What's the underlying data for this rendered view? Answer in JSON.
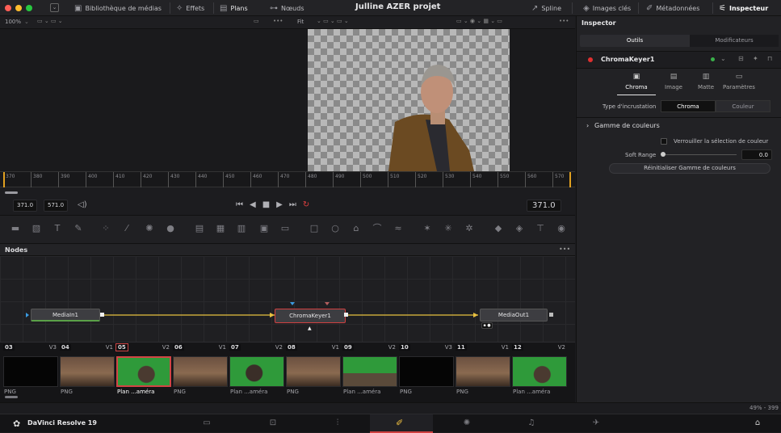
{
  "topbar": {
    "media_pool": "Bibliothèque de médias",
    "effects": "Effets",
    "clips": "Plans",
    "nodes": "Nœuds",
    "project_title": "Julline AZER projet",
    "spline": "Spline",
    "keyframes": "Images clés",
    "metadata": "Métadonnées",
    "inspector": "Inspecteur"
  },
  "viewerbar": {
    "zoom": "100%",
    "fit": "Fit"
  },
  "ruler": {
    "ticks": [
      "370",
      "380",
      "390",
      "400",
      "410",
      "420",
      "430",
      "440",
      "450",
      "460",
      "470",
      "480",
      "490",
      "500",
      "510",
      "520",
      "530",
      "540",
      "550",
      "560",
      "570"
    ]
  },
  "transport": {
    "in_point": "371.0",
    "out_point": "571.0",
    "current_time": "371.0"
  },
  "nodes_panel": {
    "title": "Nodes",
    "more": "•••",
    "node_in": "MediaIn1",
    "node_key": "ChromaKeyer1",
    "node_out": "MediaOut1"
  },
  "clips": [
    {
      "num": "03",
      "track": "V3",
      "label": "PNG",
      "kind": "black"
    },
    {
      "num": "04",
      "track": "V1",
      "label": "PNG",
      "kind": "room"
    },
    {
      "num": "05",
      "track": "V2",
      "label": "Plan ...améra",
      "kind": "green",
      "selected": true
    },
    {
      "num": "06",
      "track": "V1",
      "label": "PNG",
      "kind": "room"
    },
    {
      "num": "07",
      "track": "V2",
      "label": "Plan ...améra",
      "kind": "green"
    },
    {
      "num": "08",
      "track": "V1",
      "label": "PNG",
      "kind": "room"
    },
    {
      "num": "09",
      "track": "V2",
      "label": "Plan ...améra",
      "kind": "green"
    },
    {
      "num": "10",
      "track": "V3",
      "label": "PNG",
      "kind": "black"
    },
    {
      "num": "11",
      "track": "V1",
      "label": "PNG",
      "kind": "room"
    },
    {
      "num": "12",
      "track": "V2",
      "label": "Plan ...améra",
      "kind": "green"
    }
  ],
  "status": {
    "zoom": "49% - 399"
  },
  "app": {
    "name": "DaVinci Resolve 19"
  },
  "inspector": {
    "title": "Inspector",
    "tab_tools": "Outils",
    "tab_modifiers": "Modificateurs",
    "node_name": "ChromaKeyer1",
    "subtabs": [
      "Chroma",
      "Image",
      "Matte",
      "Paramètres"
    ],
    "keytype_label": "Type d'incrustation",
    "keytype_options": [
      "Chroma",
      "Couleur"
    ],
    "section": "Gamme de couleurs",
    "lock_label": "Verrouiller la sélection de couleur",
    "soft_range_label": "Soft Range",
    "soft_range_value": "0.0",
    "reset_label": "Réinitialiser Gamme de couleurs"
  }
}
